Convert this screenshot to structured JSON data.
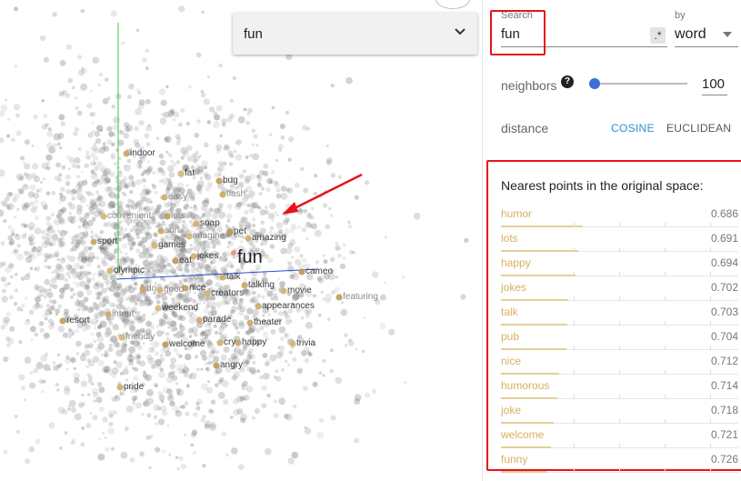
{
  "viz": {
    "select_value": "fun",
    "labels": [
      {
        "text": "indoor"
      },
      {
        "text": "fat"
      },
      {
        "text": "bug"
      },
      {
        "text": "easy"
      },
      {
        "text": "flash"
      },
      {
        "text": "convenient"
      },
      {
        "text": "lots"
      },
      {
        "text": "soap"
      },
      {
        "text": "sort"
      },
      {
        "text": "imagine"
      },
      {
        "text": "pet"
      },
      {
        "text": "amazing"
      },
      {
        "text": "sport"
      },
      {
        "text": "games"
      },
      {
        "text": "eat"
      },
      {
        "text": "jokes"
      },
      {
        "text": "fun"
      },
      {
        "text": "olympic"
      },
      {
        "text": "cameo"
      },
      {
        "text": "talk"
      },
      {
        "text": "do"
      },
      {
        "text": "good"
      },
      {
        "text": "nice"
      },
      {
        "text": "creators"
      },
      {
        "text": "talking"
      },
      {
        "text": "movie"
      },
      {
        "text": "featuring"
      },
      {
        "text": "appearances"
      },
      {
        "text": "intent"
      },
      {
        "text": "weekend"
      },
      {
        "text": "resort"
      },
      {
        "text": "parade"
      },
      {
        "text": "theater"
      },
      {
        "text": "friendly"
      },
      {
        "text": "welcome"
      },
      {
        "text": "cry"
      },
      {
        "text": "happy"
      },
      {
        "text": "trivia"
      },
      {
        "text": "angry"
      },
      {
        "text": "pride"
      }
    ]
  },
  "panel": {
    "search_caption": "Search",
    "search_value": "fun",
    "regex_label": ".*",
    "by_caption": "by",
    "by_value": "word",
    "neighbors_label": "neighbors",
    "help_icon": "?",
    "neighbors_value": "100",
    "neighbors_slider_level": 0.06,
    "distance_label": "distance",
    "cosine_label": "COSINE",
    "euclidean_label": "EUCLIDEAN",
    "nn_heading": "Nearest points in the original space:",
    "neighbors": [
      {
        "word": "humor",
        "score": "0.686"
      },
      {
        "word": "lots",
        "score": "0.691"
      },
      {
        "word": "happy",
        "score": "0.694"
      },
      {
        "word": "jokes",
        "score": "0.702"
      },
      {
        "word": "talk",
        "score": "0.703"
      },
      {
        "word": "pub",
        "score": "0.704"
      },
      {
        "word": "nice",
        "score": "0.712"
      },
      {
        "word": "humorous",
        "score": "0.714"
      },
      {
        "word": "joke",
        "score": "0.718"
      },
      {
        "word": "welcome",
        "score": "0.721"
      },
      {
        "word": "funny",
        "score": "0.726"
      }
    ]
  },
  "colors": {
    "highlight": "#e8121b",
    "accent": "#2d8fd5",
    "neighbor": "#d7b060",
    "slider": "#3b6fd6"
  }
}
